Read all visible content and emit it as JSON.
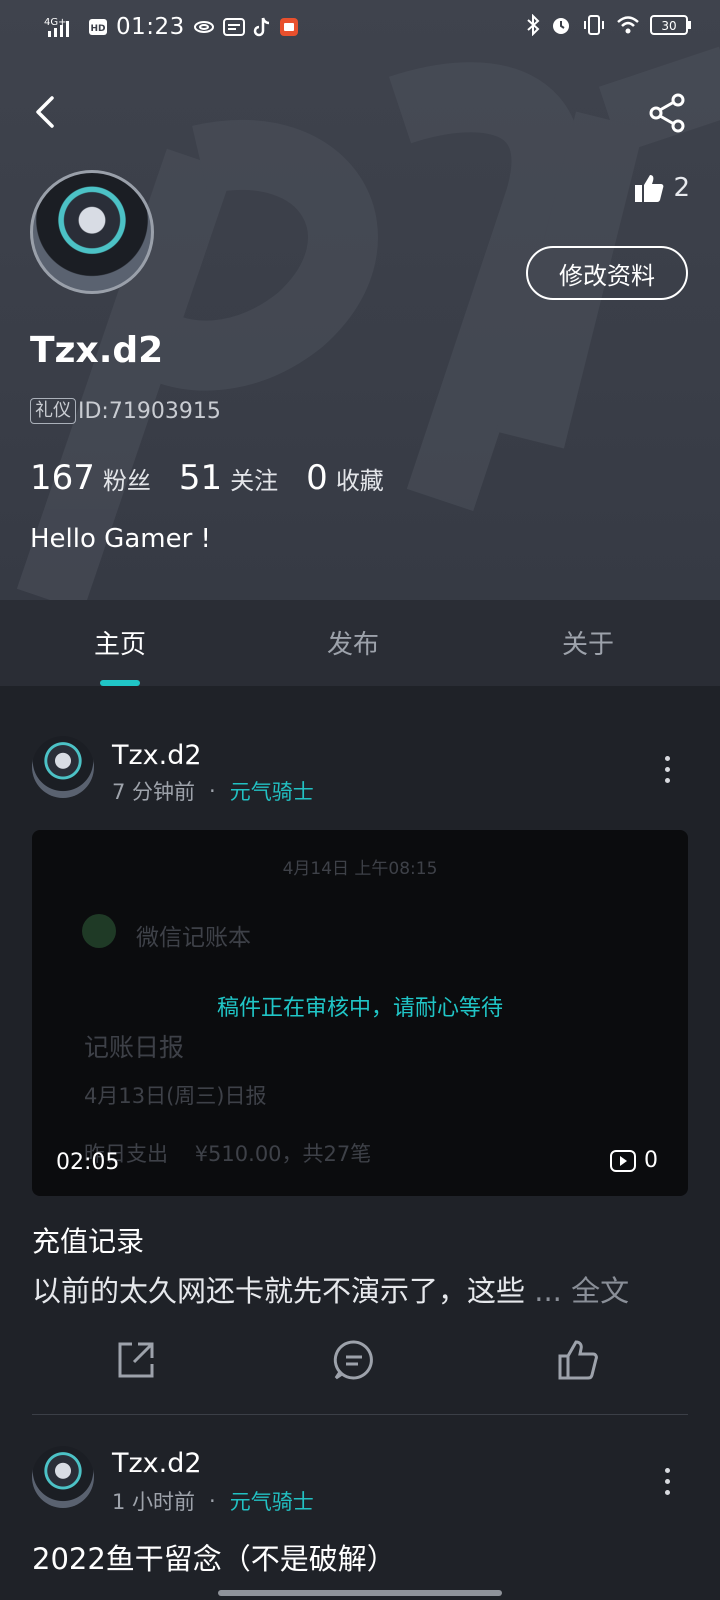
{
  "status_bar": {
    "network": "4G+",
    "hd": "HD",
    "time": "01:23",
    "battery": "30",
    "app_icons": [
      "hotspot-icon",
      "message-icon",
      "tiktok-icon",
      "listen-app-icon"
    ]
  },
  "profile": {
    "username": "Tzx.d2",
    "badge": "礼仪",
    "id_text": "ID:71903915",
    "likes": "2",
    "edit_button": "修改资料",
    "stats": [
      {
        "value": "167",
        "label": "粉丝"
      },
      {
        "value": "51",
        "label": "关注"
      },
      {
        "value": "0",
        "label": "收藏"
      }
    ],
    "bio": "Hello Gamer !"
  },
  "tabs": [
    {
      "label": "主页",
      "active": true
    },
    {
      "label": "发布",
      "active": false
    },
    {
      "label": "关于",
      "active": false
    }
  ],
  "posts": [
    {
      "author": "Tzx.d2",
      "time": "7 分钟前",
      "separator": "·",
      "game": "元气骑士",
      "video": {
        "faint_date": "4月14日 上午08:15",
        "faint_app": "微信记账本",
        "faint_report": "记账日报",
        "faint_day": "4月13日(周三)日报",
        "faint_spend": "昨日支出    ¥510.00，共27笔",
        "review_text": "稿件正在审核中，请耐心等待",
        "duration": "02:05",
        "views": "0"
      },
      "title": "充值记录",
      "excerpt": "以前的太久网还卡就先不演示了，这些",
      "ellipsis": "...",
      "full_text_link": "全文"
    },
    {
      "author": "Tzx.d2",
      "time": "1 小时前",
      "separator": "·",
      "game": "元气骑士",
      "title": "2022鱼干留念（不是破解）"
    }
  ],
  "colors": {
    "accent": "#20c6c7",
    "header_bg": "#3f434d",
    "page_bg": "#1f2228"
  }
}
